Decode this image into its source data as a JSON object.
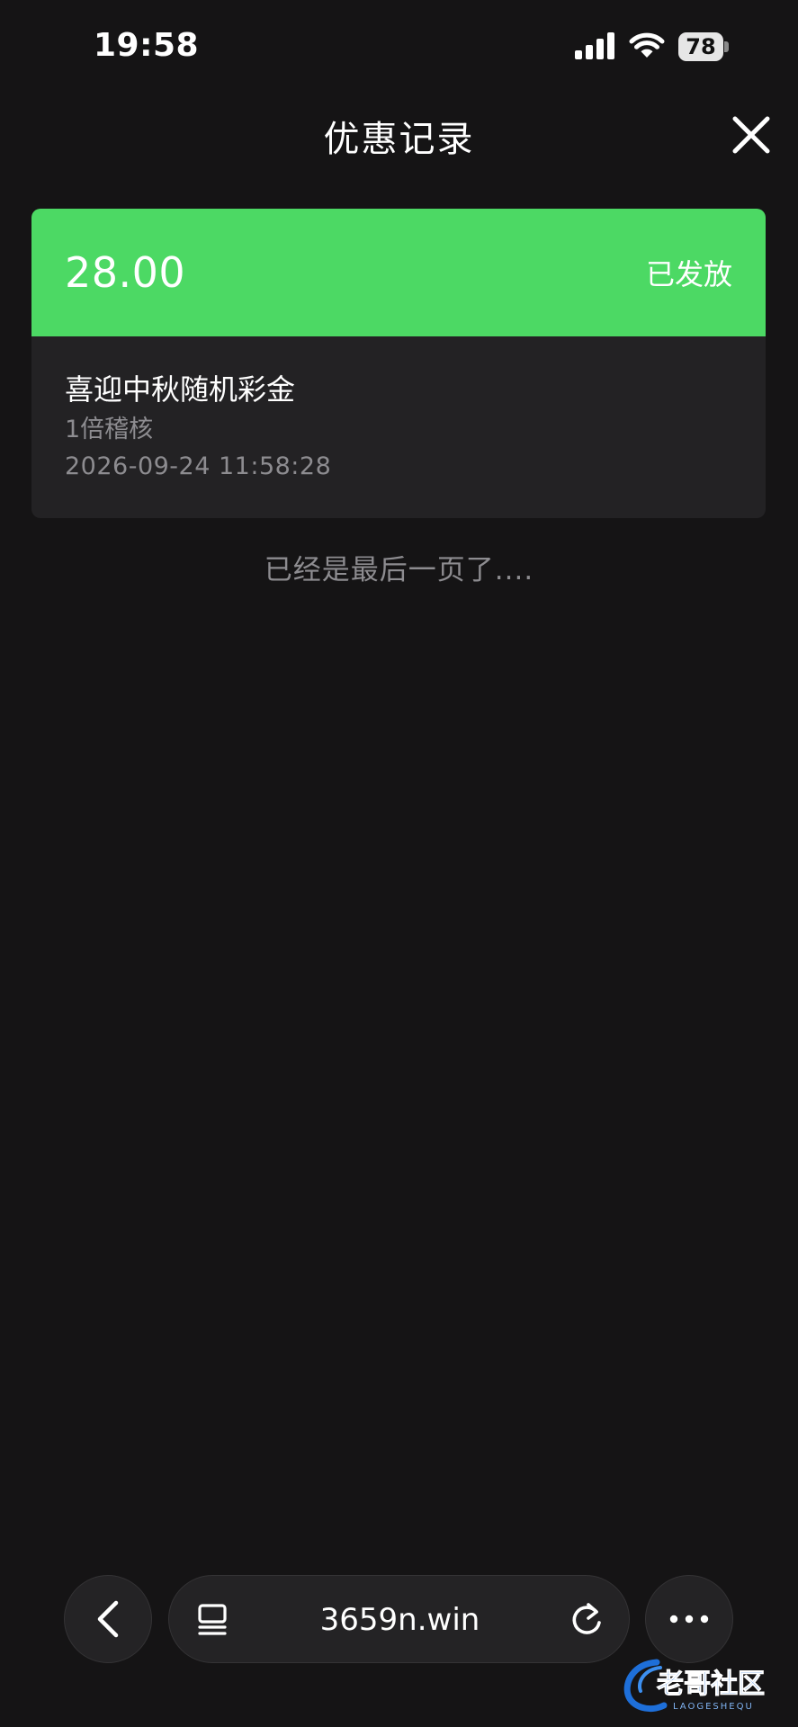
{
  "status_bar": {
    "time": "19:58",
    "battery": "78",
    "icons": [
      "signal-icon",
      "wifi-icon",
      "battery-icon"
    ]
  },
  "header": {
    "title": "优惠记录",
    "close_icon": "close-icon"
  },
  "record": {
    "amount": "28.00",
    "status": "已发放",
    "title": "喜迎中秋随机彩金",
    "requirement": "1倍稽核",
    "time": "2026-09-24 11:58:28"
  },
  "list_end_text": "已经是最后一页了....",
  "browser_bar": {
    "url": "3659n.win",
    "icons": [
      "back-icon",
      "tabs-icon",
      "reload-icon",
      "more-icon"
    ]
  },
  "watermark": {
    "text": "老哥社区",
    "subtext": "LAOGESHEQU"
  },
  "colors": {
    "background": "#151415",
    "card": "#232224",
    "accent_green": "#4cd964",
    "muted_text": "#8d8c90"
  }
}
